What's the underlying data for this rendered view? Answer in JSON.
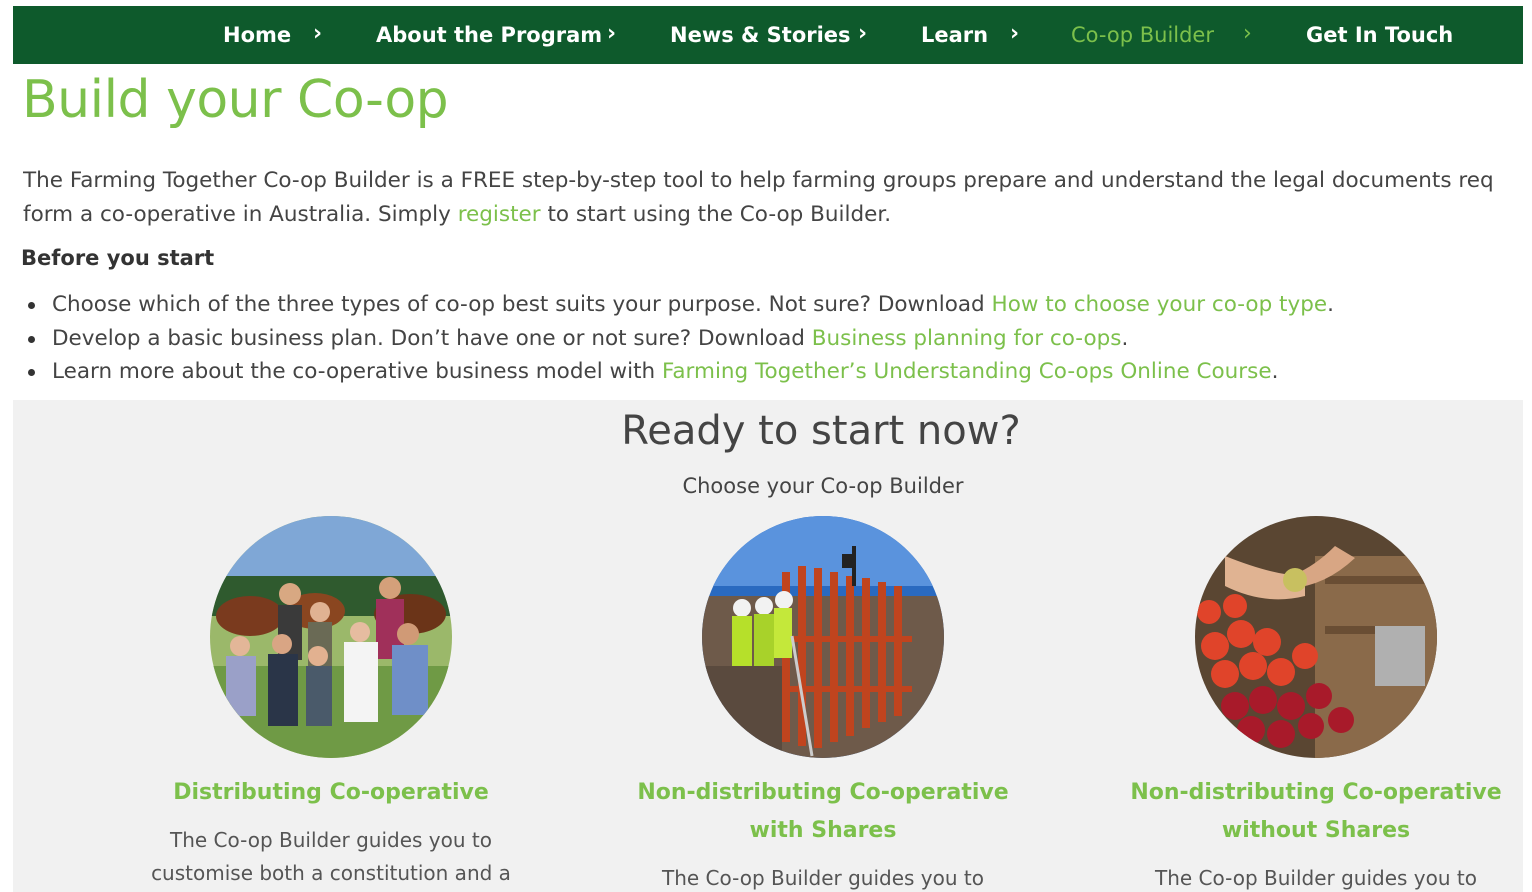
{
  "nav": {
    "items": [
      {
        "label": "Home"
      },
      {
        "label": "About the Program"
      },
      {
        "label": "News & Stories"
      },
      {
        "label": "Learn"
      },
      {
        "label": "Co-op Builder"
      },
      {
        "label": "Get In Touch"
      }
    ],
    "chevron": "›",
    "active_index": 4
  },
  "page": {
    "title": "Build your Co-op",
    "intro_part1": "The Farming Together Co-op Builder is a FREE step-by-step tool to help farming groups prepare and understand the legal documents req",
    "intro_part2": "form a co-operative in Australia. Simply ",
    "intro_link": "register",
    "intro_part3": " to start using the Co-op Builder."
  },
  "before": {
    "heading": "Before you start",
    "items": [
      {
        "text": "Choose which of the three types of co-op best suits your purpose. Not sure? Download ",
        "link": "How to choose your co-op type",
        "end": "."
      },
      {
        "text": "Develop a basic business plan. Don’t have one or not sure? Download ",
        "link": "Business planning for co-ops",
        "end": "."
      },
      {
        "text": "Learn more about the co-operative business model with ",
        "link": "Farming Together’s Understanding Co-ops Online Course",
        "end": "."
      }
    ]
  },
  "ready": {
    "title": "Ready to start now?",
    "subtitle": "Choose your Co-op Builder",
    "cards": [
      {
        "title": "Distributing Co-operative",
        "desc_line1": "The Co-op Builder guides you to",
        "desc_line2": "customise both a constitution and a"
      },
      {
        "title_line1": "Non-distributing Co-operative",
        "title_line2": "with Shares",
        "desc_line1": "The Co-op Builder guides you to"
      },
      {
        "title_line1": "Non-distributing Co-operative",
        "title_line2": "without Shares",
        "desc_line1": "The Co-op Builder guides you to"
      }
    ]
  },
  "colors": {
    "nav_bg": "#0e5a2c",
    "accent": "#7cc04b",
    "section_bg": "#f1f1f1"
  }
}
